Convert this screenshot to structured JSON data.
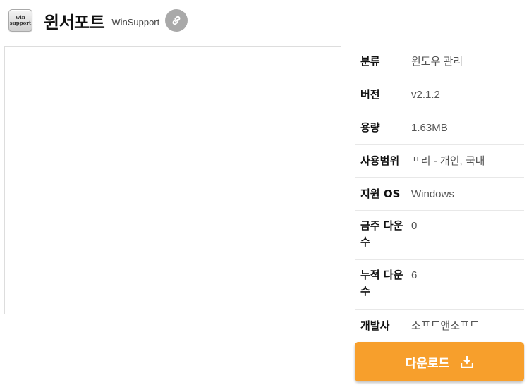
{
  "app": {
    "logo_text_line1": "win",
    "logo_text_line2": "support",
    "title": "윈서포트",
    "subtitle": "WinSupport",
    "link_icon": "link-icon"
  },
  "details": [
    {
      "label": "분류",
      "value": "윈도우 관리",
      "is_link": true
    },
    {
      "label": "버전",
      "value": "v2.1.2"
    },
    {
      "label": "용량",
      "value": "1.63MB"
    },
    {
      "label": "사용범위",
      "value": "프리 - 개인, 국내"
    },
    {
      "label": "지원 OS",
      "value": "Windows"
    },
    {
      "label": "금주 다운수",
      "value": "0"
    },
    {
      "label": "누적 다운수",
      "value": "6"
    },
    {
      "label": "개발사",
      "value": "소프트앤소프트"
    }
  ],
  "download": {
    "label": "다운로드",
    "icon": "download-icon",
    "color": "#f79f2c"
  }
}
